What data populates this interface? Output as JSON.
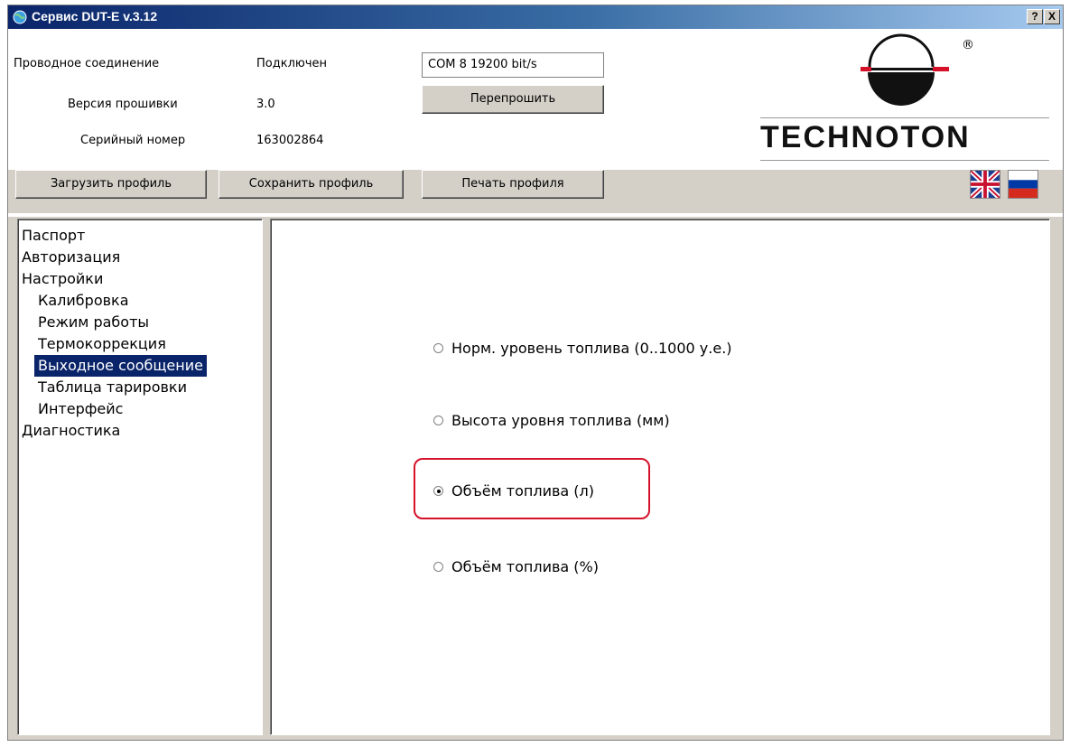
{
  "window": {
    "title": "Сервис DUT-E  v.3.12",
    "help_label": "?",
    "close_label": "X"
  },
  "header": {
    "connection_label": "Проводное соединение",
    "connection_status": "Подключен",
    "port_info": "COM 8    19200 bit/s",
    "firmware_label": "Версия прошивки",
    "firmware_value": "3.0",
    "reflash_button": "Перепрошить",
    "serial_label": "Серийный номер",
    "serial_value": "163002864",
    "logo_text": "TECHNOTON",
    "logo_registered": "®"
  },
  "toolbar": {
    "load_profile": "Загрузить профиль",
    "save_profile": "Сохранить профиль",
    "print_profile": "Печать профиля",
    "lang_english": "English",
    "lang_russian": "Русский"
  },
  "tree": {
    "items": [
      {
        "label": "Паспорт"
      },
      {
        "label": "Авторизация"
      },
      {
        "label": "Настройки"
      },
      {
        "label": "Калибровка"
      },
      {
        "label": "Режим работы"
      },
      {
        "label": "Термокоррекция"
      },
      {
        "label": "Выходное сообщение"
      },
      {
        "label": "Таблица тарировки"
      },
      {
        "label": "Интерфейс"
      },
      {
        "label": "Диагностика"
      }
    ],
    "selected": "Выходное сообщение"
  },
  "output_message": {
    "options": [
      {
        "label": "Норм. уровень топлива (0..1000 у.е.)",
        "selected": false
      },
      {
        "label": "Высота уровня топлива  (мм)",
        "selected": false
      },
      {
        "label": "Объём топлива  (л)",
        "selected": true
      },
      {
        "label": "Объём топлива  (%)",
        "selected": false
      }
    ]
  },
  "colors": {
    "title_gradient_start": "#0a246a",
    "selection": "#0a246a",
    "highlight": "#d6112a",
    "logo_red": "#d6112a"
  }
}
